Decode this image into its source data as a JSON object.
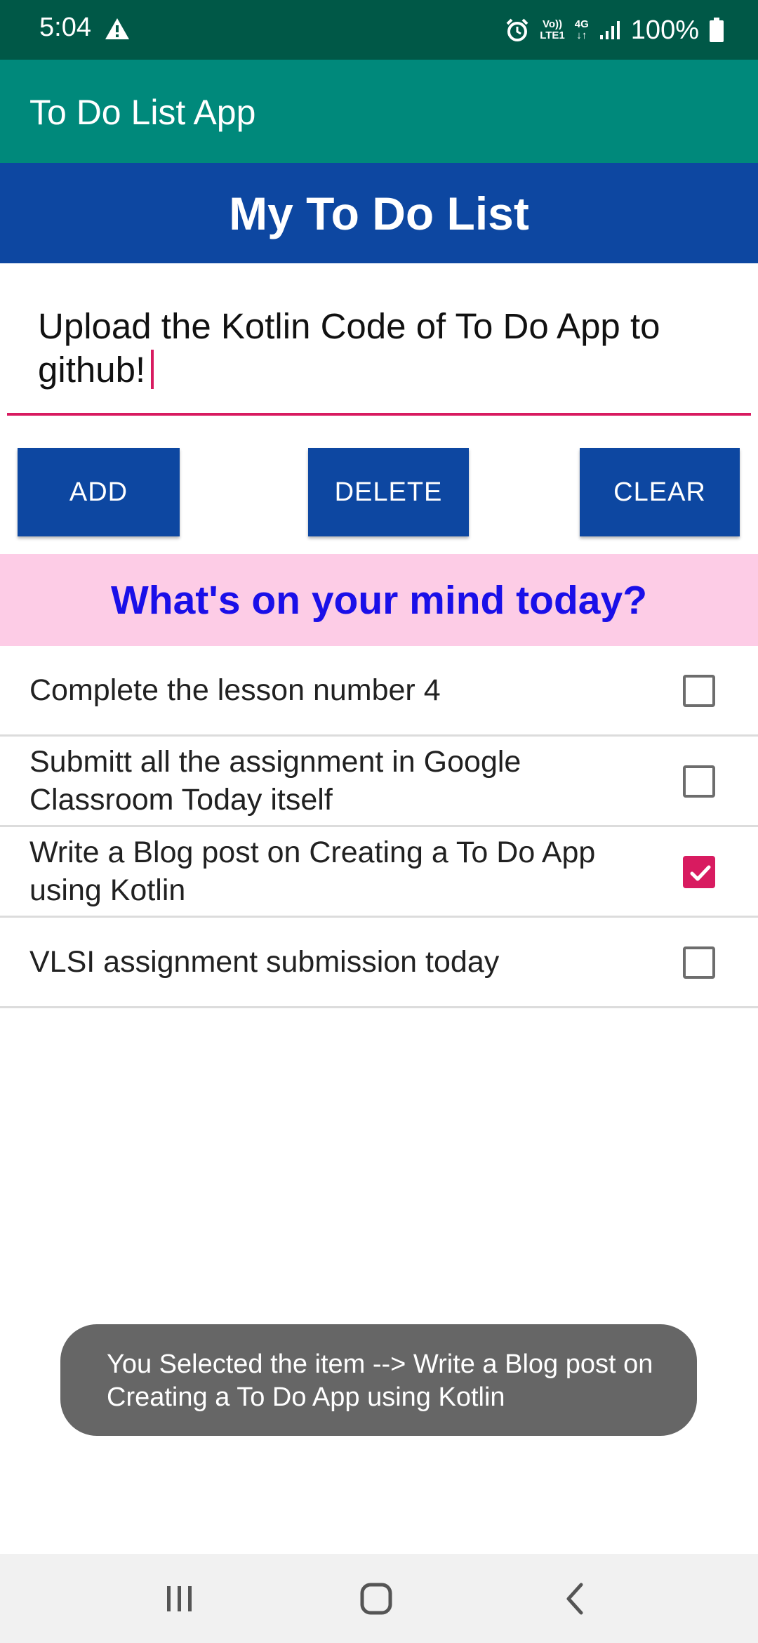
{
  "status_bar": {
    "time": "5:04",
    "network_label_top": "Vo))",
    "network_label_bottom": "LTE1",
    "data_label": "4G",
    "battery": "100%"
  },
  "app_bar": {
    "title": "To Do List App"
  },
  "header": {
    "title": "My To Do List"
  },
  "input": {
    "value": "Upload the Kotlin Code of To Do App to github!"
  },
  "buttons": {
    "add": "ADD",
    "delete": "DELETE",
    "clear": "CLEAR"
  },
  "prompt": {
    "text": "What's on your mind today?"
  },
  "todos": [
    {
      "text": "Complete the lesson number 4",
      "checked": false
    },
    {
      "text": "Submitt all the assignment in Google Classroom Today itself",
      "checked": false
    },
    {
      "text": "Write a Blog post on Creating a To Do App using Kotlin",
      "checked": true
    },
    {
      "text": "VLSI assignment submission today",
      "checked": false
    }
  ],
  "toast": {
    "text": "You Selected the item --> Write a Blog post on Creating a To Do App using Kotlin"
  },
  "icons": {
    "warning": "warning-icon",
    "alarm": "alarm-icon",
    "signal": "signal-icon",
    "battery": "battery-icon",
    "recents": "recents-icon",
    "home": "home-icon",
    "back": "back-icon",
    "check": "check-icon"
  },
  "colors": {
    "status_bar": "#005847",
    "app_bar": "#00897B",
    "primary": "#0D47A1",
    "accent": "#D81B60",
    "prompt_bg": "#FDCCE6",
    "prompt_text": "#1A0FE8",
    "toast_bg": "#666666"
  }
}
